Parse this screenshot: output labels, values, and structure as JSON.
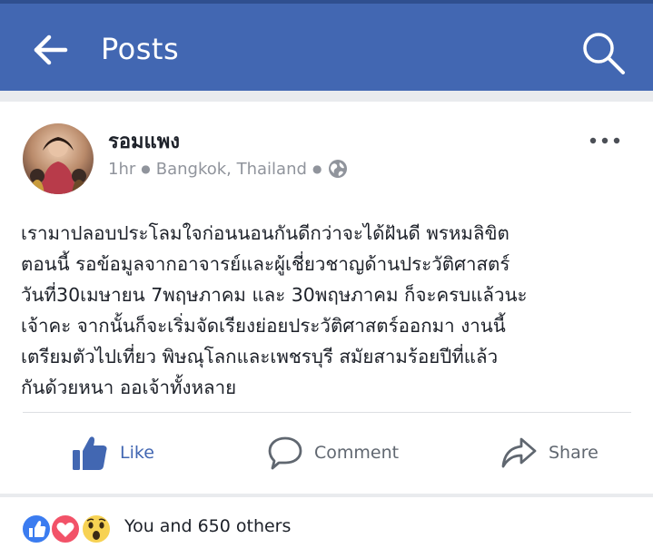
{
  "appbar": {
    "title": "Posts",
    "back_icon": "back-arrow-icon",
    "search_icon": "search-icon",
    "bg_color": "#4267b2"
  },
  "post": {
    "author": "รอมแพง",
    "time": "1hr",
    "location": "Bangkok, Thailand",
    "privacy_icon": "globe-icon",
    "more_icon": "more-horizontal-icon",
    "text_lines": [
      "เรามาปลอบประโลมใจก่อนนอนกันดีกว่าจะได้ฝันดี พรหมลิขิต",
      "ตอนนี้ รอข้อมูลจากอาจารย์และผู้เชี่ยวชาญด้านประวัติศาสตร์",
      "วันที่30เมษายน 7พฤษภาคม และ 30พฤษภาคม ก็จะครบแล้วนะ",
      "เจ้าคะ จากนั้นก็จะเริ่มจัดเรียงย่อยประวัติศาสตร์ออกมา งานนี้",
      "เตรียมตัวไปเที่ยว พิษณุโลกและเพชรบุรี สมัยสามร้อยปีที่แล้ว",
      "กันด้วยหนา ออเจ้าทั้งหลาย"
    ]
  },
  "actions": {
    "like_label": "Like",
    "comment_label": "Comment",
    "share_label": "Share",
    "like_color": "#4267b2"
  },
  "reactions": {
    "summary": "You and 650 others",
    "icons": [
      "like-reaction-icon",
      "love-reaction-icon",
      "wow-reaction-icon"
    ]
  }
}
